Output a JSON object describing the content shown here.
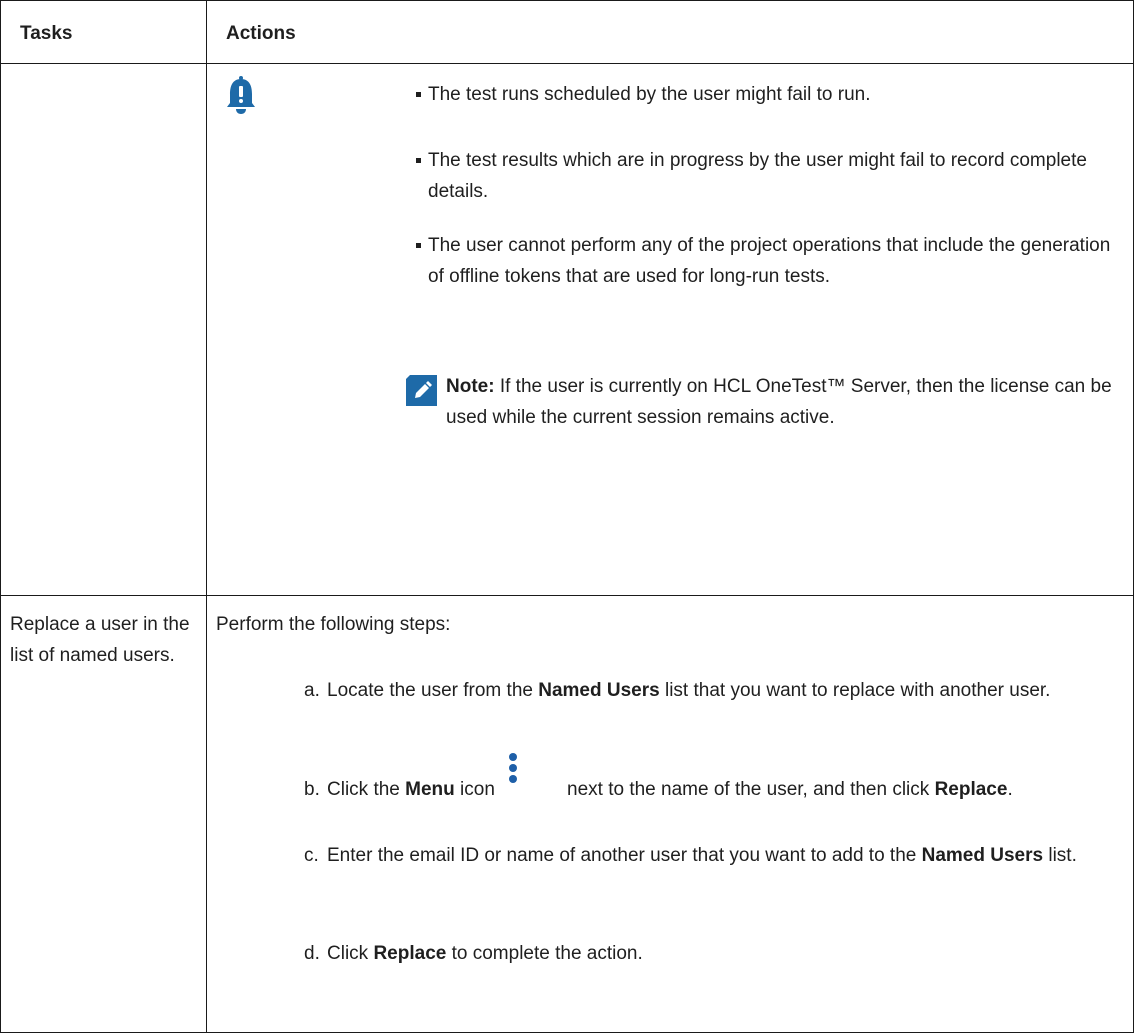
{
  "table": {
    "headers": [
      "Tasks",
      "Actions"
    ],
    "row1": {
      "caution_items": [
        "The test runs scheduled by the user might fail to run.",
        "The test results which are in progress by the user might fail to record complete details.",
        "The user cannot perform any of the project operations that include the generation of offline tokens that are used for long-run tests."
      ],
      "note_label": "Note:",
      "note_text": "If the user is currently on HCL OneTest™ Server, then the license can be used while the current session remains active."
    },
    "row2": {
      "task": "Replace a user in the list of named users.",
      "intro": "Perform the following steps:",
      "step_a": {
        "marker": "a.",
        "pre": "Locate the user from the",
        "bold": "Named Users",
        "post": "list that you want to replace with another user."
      },
      "step_b": {
        "marker": "b.",
        "pre": "Click the",
        "bold1": "Menu",
        "mid": "icon",
        "post": "next to the name of the user, and then click",
        "bold2": "Replace",
        "end": "."
      },
      "step_c": {
        "marker": "c.",
        "pre": "Enter the email ID or name of another user that you want to add to the",
        "bold": "Named Users",
        "post": "list."
      },
      "step_d": {
        "marker": "d.",
        "pre": "Click",
        "bold": "Replace",
        "post": "to complete the action."
      }
    }
  },
  "colors": {
    "text": "#1f1f1f",
    "icon_blue": "#1e6aa8",
    "border": "#1a1a1a"
  },
  "icons": [
    "caution-bell-icon",
    "note-pencil-icon",
    "menu-kebab-icon"
  ]
}
